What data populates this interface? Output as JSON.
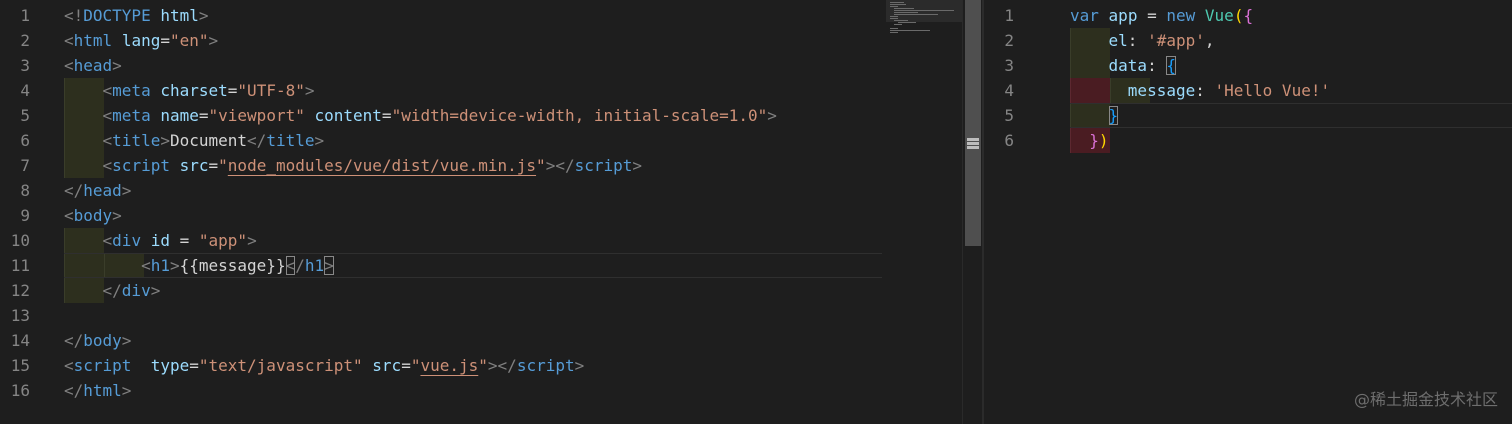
{
  "left_editor": {
    "line_numbers": [
      "1",
      "2",
      "3",
      "4",
      "5",
      "6",
      "7",
      "8",
      "9",
      "10",
      "11",
      "12",
      "13",
      "14",
      "15",
      "16"
    ],
    "lines": [
      [
        {
          "t": "<!",
          "c": "t-punct"
        },
        {
          "t": "DOCTYPE",
          "c": "t-tag"
        },
        {
          "t": " ",
          "c": "t-text"
        },
        {
          "t": "html",
          "c": "t-attr"
        },
        {
          "t": ">",
          "c": "t-punct"
        }
      ],
      [
        {
          "t": "<",
          "c": "t-punct"
        },
        {
          "t": "html",
          "c": "t-tag"
        },
        {
          "t": " ",
          "c": "t-text"
        },
        {
          "t": "lang",
          "c": "t-attr"
        },
        {
          "t": "=",
          "c": "t-text"
        },
        {
          "t": "\"en\"",
          "c": "t-str"
        },
        {
          "t": ">",
          "c": "t-punct"
        }
      ],
      [
        {
          "t": "<",
          "c": "t-punct"
        },
        {
          "t": "head",
          "c": "t-tag"
        },
        {
          "t": ">",
          "c": "t-punct"
        }
      ],
      [
        {
          "t": "    ",
          "c": "t-text"
        },
        {
          "t": "<",
          "c": "t-punct"
        },
        {
          "t": "meta",
          "c": "t-tag"
        },
        {
          "t": " ",
          "c": "t-text"
        },
        {
          "t": "charset",
          "c": "t-attr"
        },
        {
          "t": "=",
          "c": "t-text"
        },
        {
          "t": "\"UTF-8\"",
          "c": "t-str"
        },
        {
          "t": ">",
          "c": "t-punct"
        }
      ],
      [
        {
          "t": "    ",
          "c": "t-text"
        },
        {
          "t": "<",
          "c": "t-punct"
        },
        {
          "t": "meta",
          "c": "t-tag"
        },
        {
          "t": " ",
          "c": "t-text"
        },
        {
          "t": "name",
          "c": "t-attr"
        },
        {
          "t": "=",
          "c": "t-text"
        },
        {
          "t": "\"viewport\"",
          "c": "t-str"
        },
        {
          "t": " ",
          "c": "t-text"
        },
        {
          "t": "content",
          "c": "t-attr"
        },
        {
          "t": "=",
          "c": "t-text"
        },
        {
          "t": "\"width=device-width, initial-scale=1.0\"",
          "c": "t-str"
        },
        {
          "t": ">",
          "c": "t-punct"
        }
      ],
      [
        {
          "t": "    ",
          "c": "t-text"
        },
        {
          "t": "<",
          "c": "t-punct"
        },
        {
          "t": "title",
          "c": "t-tag"
        },
        {
          "t": ">",
          "c": "t-punct"
        },
        {
          "t": "Document",
          "c": "t-text"
        },
        {
          "t": "</",
          "c": "t-punct"
        },
        {
          "t": "title",
          "c": "t-tag"
        },
        {
          "t": ">",
          "c": "t-punct"
        }
      ],
      [
        {
          "t": "    ",
          "c": "t-text"
        },
        {
          "t": "<",
          "c": "t-punct"
        },
        {
          "t": "script",
          "c": "t-tag"
        },
        {
          "t": " ",
          "c": "t-text"
        },
        {
          "t": "src",
          "c": "t-attr"
        },
        {
          "t": "=",
          "c": "t-text"
        },
        {
          "t": "\"",
          "c": "t-str"
        },
        {
          "t": "node_modules/vue/dist/vue.min.js",
          "c": "t-str underline"
        },
        {
          "t": "\"",
          "c": "t-str"
        },
        {
          "t": "></",
          "c": "t-punct"
        },
        {
          "t": "script",
          "c": "t-tag"
        },
        {
          "t": ">",
          "c": "t-punct"
        }
      ],
      [
        {
          "t": "</",
          "c": "t-punct"
        },
        {
          "t": "head",
          "c": "t-tag"
        },
        {
          "t": ">",
          "c": "t-punct"
        }
      ],
      [
        {
          "t": "<",
          "c": "t-punct"
        },
        {
          "t": "body",
          "c": "t-tag"
        },
        {
          "t": ">",
          "c": "t-punct"
        }
      ],
      [
        {
          "t": "    ",
          "c": "t-text"
        },
        {
          "t": "<",
          "c": "t-punct"
        },
        {
          "t": "div",
          "c": "t-tag"
        },
        {
          "t": " ",
          "c": "t-text"
        },
        {
          "t": "id",
          "c": "t-attr"
        },
        {
          "t": " = ",
          "c": "t-text"
        },
        {
          "t": "\"app\"",
          "c": "t-str"
        },
        {
          "t": ">",
          "c": "t-punct"
        }
      ],
      [
        {
          "t": "        ",
          "c": "t-text"
        },
        {
          "t": "<",
          "c": "t-punct"
        },
        {
          "t": "h1",
          "c": "t-tag"
        },
        {
          "t": ">",
          "c": "t-punct"
        },
        {
          "t": "{{message}}",
          "c": "t-text"
        },
        {
          "t": "<",
          "c": "t-punct bracket-box"
        },
        {
          "t": "/",
          "c": "t-punct"
        },
        {
          "t": "h1",
          "c": "t-tag"
        },
        {
          "t": ">",
          "c": "t-punct bracket-box"
        }
      ],
      [
        {
          "t": "    ",
          "c": "t-text"
        },
        {
          "t": "</",
          "c": "t-punct"
        },
        {
          "t": "div",
          "c": "t-tag"
        },
        {
          "t": ">",
          "c": "t-punct"
        }
      ],
      [],
      [
        {
          "t": "</",
          "c": "t-punct"
        },
        {
          "t": "body",
          "c": "t-tag"
        },
        {
          "t": ">",
          "c": "t-punct"
        }
      ],
      [
        {
          "t": "<",
          "c": "t-punct"
        },
        {
          "t": "script",
          "c": "t-tag"
        },
        {
          "t": "  ",
          "c": "t-text"
        },
        {
          "t": "type",
          "c": "t-attr"
        },
        {
          "t": "=",
          "c": "t-text"
        },
        {
          "t": "\"text/javascript\"",
          "c": "t-str"
        },
        {
          "t": " ",
          "c": "t-text"
        },
        {
          "t": "src",
          "c": "t-attr"
        },
        {
          "t": "=",
          "c": "t-text"
        },
        {
          "t": "\"",
          "c": "t-str"
        },
        {
          "t": "vue.js",
          "c": "t-str underline"
        },
        {
          "t": "\"",
          "c": "t-str"
        },
        {
          "t": "></",
          "c": "t-punct"
        },
        {
          "t": "script",
          "c": "t-tag"
        },
        {
          "t": ">",
          "c": "t-punct"
        }
      ],
      [
        {
          "t": "</",
          "c": "t-punct"
        },
        {
          "t": "html",
          "c": "t-tag"
        },
        {
          "t": ">",
          "c": "t-punct"
        }
      ]
    ]
  },
  "right_editor": {
    "line_numbers": [
      "1",
      "2",
      "3",
      "4",
      "5",
      "6"
    ],
    "lines": [
      [
        {
          "t": "var",
          "c": "t-kw"
        },
        {
          "t": " ",
          "c": "t-text"
        },
        {
          "t": "app",
          "c": "t-prop"
        },
        {
          "t": " = ",
          "c": "t-text"
        },
        {
          "t": "new",
          "c": "t-kw"
        },
        {
          "t": " ",
          "c": "t-text"
        },
        {
          "t": "Vue",
          "c": "t-fn"
        },
        {
          "t": "(",
          "c": "t-brace-y"
        },
        {
          "t": "{",
          "c": "t-brace-p"
        }
      ],
      [
        {
          "t": "    ",
          "c": "t-text"
        },
        {
          "t": "el",
          "c": "t-prop"
        },
        {
          "t": ": ",
          "c": "t-text"
        },
        {
          "t": "'#app'",
          "c": "t-str"
        },
        {
          "t": ",",
          "c": "t-text"
        }
      ],
      [
        {
          "t": "    ",
          "c": "t-text"
        },
        {
          "t": "data",
          "c": "t-prop"
        },
        {
          "t": ": ",
          "c": "t-text"
        },
        {
          "t": "{",
          "c": "t-brace-b bracket-box"
        }
      ],
      [
        {
          "t": "      ",
          "c": "t-text"
        },
        {
          "t": "message",
          "c": "t-prop"
        },
        {
          "t": ": ",
          "c": "t-text"
        },
        {
          "t": "'Hello Vue!'",
          "c": "t-str"
        }
      ],
      [
        {
          "t": "    ",
          "c": "t-text"
        },
        {
          "t": "}",
          "c": "t-brace-b bracket-box"
        }
      ],
      [
        {
          "t": "  ",
          "c": "t-text"
        },
        {
          "t": "}",
          "c": "t-brace-p"
        },
        {
          "t": ")",
          "c": "t-brace-y"
        }
      ]
    ]
  },
  "watermark": "@稀土掘金技术社区",
  "colors": {
    "background": "#1e1e1e",
    "tag": "#569cd6",
    "attribute": "#9cdcfe",
    "string": "#ce9178",
    "line_number": "#858585"
  }
}
